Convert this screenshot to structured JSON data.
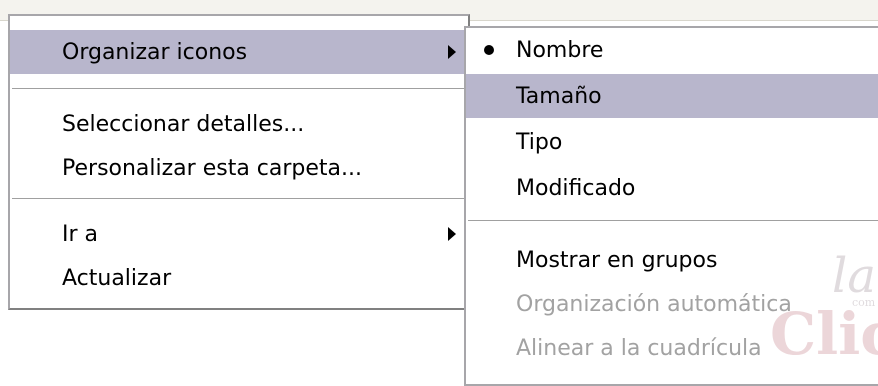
{
  "menu": {
    "items": [
      {
        "label": "Organizar iconos",
        "highlighted": true,
        "submenu": true
      },
      {
        "label": "Seleccionar detalles..."
      },
      {
        "label": "Personalizar esta carpeta..."
      },
      {
        "label": "Ir a",
        "submenu": true
      },
      {
        "label": "Actualizar"
      }
    ]
  },
  "submenu": {
    "items": [
      {
        "label": "Nombre",
        "checked": true
      },
      {
        "label": "Tamaño",
        "highlighted": true
      },
      {
        "label": "Tipo"
      },
      {
        "label": "Modificado"
      },
      {
        "label": "Mostrar en grupos"
      },
      {
        "label": "Organización automática",
        "disabled": true
      },
      {
        "label": "Alinear a la cuadrícula",
        "disabled": true
      }
    ]
  },
  "watermark": {
    "line1": "la",
    "line2": "Clic",
    "small": "com"
  },
  "colors": {
    "highlight": "#b8b6cc",
    "disabled_text": "#a2a2a2",
    "border": "#a7a6aa"
  }
}
